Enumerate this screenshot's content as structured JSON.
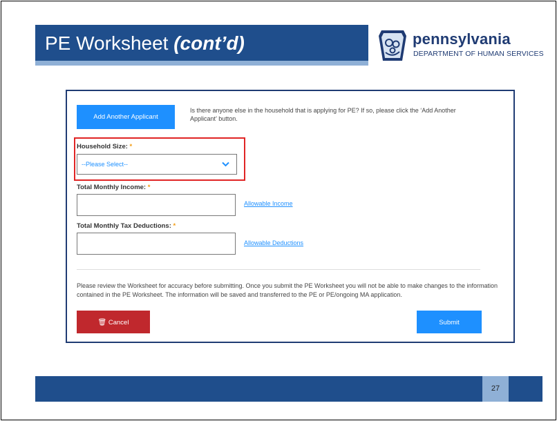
{
  "slide": {
    "title_main": "PE Worksheet ",
    "title_italic": "(cont’d)",
    "page_number": "27"
  },
  "logo": {
    "name": "pennsylvania",
    "dept": "DEPARTMENT OF HUMAN SERVICES",
    "icon": "keystone-family-icon"
  },
  "form": {
    "add_applicant_button": "Add Another Applicant",
    "add_applicant_desc": "Is there anyone else in the household that is applying for PE? If so, please click the ‘Add Another Applicant’ button.",
    "household_size_label": "Household Size:",
    "household_size_value": "--Please Select--",
    "income_label": "Total Monthly Income:",
    "income_link": "Allowable Income",
    "tax_label": "Total Monthly Tax Deductions:",
    "tax_link": "Allowable Deductions",
    "required_marker": "*",
    "notice": "Please review the Worksheet for accuracy before submitting. Once you submit the PE Worksheet you will not be able to make changes to the information contained in the PE Worksheet. The information will be saved and transferred to the PE or PE/ongoing MA application.",
    "cancel_button": "Cancel",
    "submit_button": "Submit"
  },
  "colors": {
    "title_bar": "#1f4e8c",
    "accent_blue": "#1e90ff",
    "cancel_red": "#c0282d",
    "highlight_red": "#e02424",
    "required_orange": "#f39c12"
  }
}
